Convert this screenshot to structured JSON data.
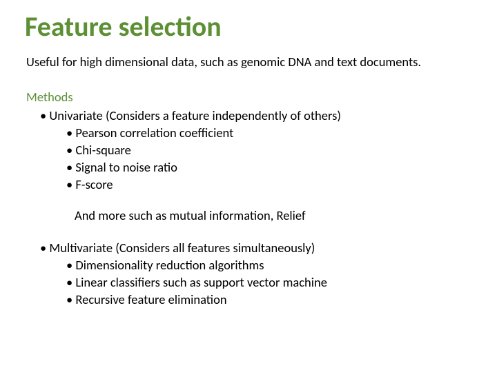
{
  "title": "Feature selection",
  "intro": "Useful for high dimensional data, such as genomic DNA and text documents.",
  "methods_label": "Methods",
  "univariate": {
    "heading": "Univariate (Considers a feature independently of others)",
    "items": [
      "Pearson correlation coefficient",
      "Chi-square",
      "Signal to noise ratio",
      "F-score"
    ],
    "and_more": "And more such as mutual information, Relief"
  },
  "multivariate": {
    "heading": "Multivariate (Considers all features simultaneously)",
    "items": [
      "Dimensionality reduction algorithms",
      "Linear classifiers such as support vector machine",
      "Recursive feature elimination"
    ]
  }
}
